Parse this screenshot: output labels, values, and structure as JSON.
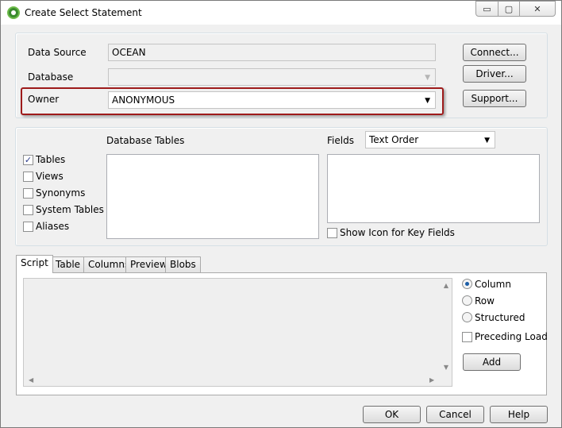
{
  "window": {
    "title": "Create Select Statement",
    "controls": {
      "minimize": "▭",
      "maximize": "▢",
      "close": "✕"
    }
  },
  "connection": {
    "data_source_label": "Data Source",
    "data_source_value": "OCEAN",
    "database_label": "Database",
    "database_value": "",
    "owner_label": "Owner",
    "owner_value": "ANONYMOUS",
    "connect_button": "Connect...",
    "driver_button": "Driver...",
    "support_button": "Support...",
    "highlight_color": "#9e1b1b"
  },
  "tables": {
    "heading": "Database Tables",
    "filters": [
      {
        "label": "Tables",
        "checked": true
      },
      {
        "label": "Views",
        "checked": false
      },
      {
        "label": "Synonyms",
        "checked": false
      },
      {
        "label": "System Tables",
        "checked": false
      },
      {
        "label": "Aliases",
        "checked": false
      }
    ]
  },
  "fields": {
    "label": "Fields",
    "order_value": "Text Order",
    "show_icon_label": "Show Icon for Key Fields",
    "show_icon_checked": false
  },
  "tabs": [
    {
      "label": "Script",
      "active": true
    },
    {
      "label": "Table",
      "active": false
    },
    {
      "label": "Columns",
      "active": false
    },
    {
      "label": "Preview",
      "active": false
    },
    {
      "label": "Blobs",
      "active": false
    }
  ],
  "script_options": {
    "radios": [
      {
        "label": "Column",
        "selected": true
      },
      {
        "label": "Row",
        "selected": false
      },
      {
        "label": "Structured",
        "selected": false
      }
    ],
    "preceding_load_label": "Preceding Load",
    "preceding_load_checked": false,
    "add_button": "Add"
  },
  "footer": {
    "ok": "OK",
    "cancel": "Cancel",
    "help": "Help"
  }
}
